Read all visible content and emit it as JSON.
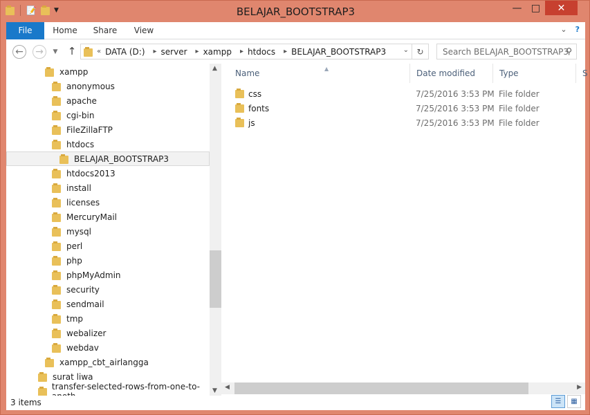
{
  "window": {
    "title": "BELAJAR_BOOTSTRAP3"
  },
  "ribbon": {
    "tabs": [
      "File",
      "Home",
      "Share",
      "View"
    ]
  },
  "nav": {
    "crumbs": [
      "DATA (D:)",
      "server",
      "xampp",
      "htdocs",
      "BELAJAR_BOOTSTRAP3"
    ],
    "search_placeholder": "Search BELAJAR_BOOTSTRAP3"
  },
  "tree": [
    {
      "label": "xampp",
      "level": 1
    },
    {
      "label": "anonymous",
      "level": 2
    },
    {
      "label": "apache",
      "level": 2
    },
    {
      "label": "cgi-bin",
      "level": 2
    },
    {
      "label": "FileZillaFTP",
      "level": 2
    },
    {
      "label": "htdocs",
      "level": 2
    },
    {
      "label": "BELAJAR_BOOTSTRAP3",
      "level": 3,
      "selected": true
    },
    {
      "label": "htdocs2013",
      "level": 2
    },
    {
      "label": "install",
      "level": 2
    },
    {
      "label": "licenses",
      "level": 2
    },
    {
      "label": "MercuryMail",
      "level": 2
    },
    {
      "label": "mysql",
      "level": 2
    },
    {
      "label": "perl",
      "level": 2
    },
    {
      "label": "php",
      "level": 2
    },
    {
      "label": "phpMyAdmin",
      "level": 2
    },
    {
      "label": "security",
      "level": 2
    },
    {
      "label": "sendmail",
      "level": 2
    },
    {
      "label": "tmp",
      "level": 2
    },
    {
      "label": "webalizer",
      "level": 2
    },
    {
      "label": "webdav",
      "level": 2
    },
    {
      "label": "xampp_cbt_airlangga",
      "level": 1
    },
    {
      "label": "surat liwa",
      "level": 0
    },
    {
      "label": "transfer-selected-rows-from-one-to-anoth",
      "level": 0
    }
  ],
  "columns": {
    "name": "Name",
    "date": "Date modified",
    "type": "Type",
    "size": "S"
  },
  "files": [
    {
      "name": "css",
      "date": "7/25/2016 3:53 PM",
      "type": "File folder"
    },
    {
      "name": "fonts",
      "date": "7/25/2016 3:53 PM",
      "type": "File folder"
    },
    {
      "name": "js",
      "date": "7/25/2016 3:53 PM",
      "type": "File folder"
    }
  ],
  "status": {
    "items": "3 items"
  },
  "colors": {
    "accent": "#1979ca",
    "frame": "#e0866e",
    "close": "#c7402f",
    "folder": "#e9c059"
  }
}
